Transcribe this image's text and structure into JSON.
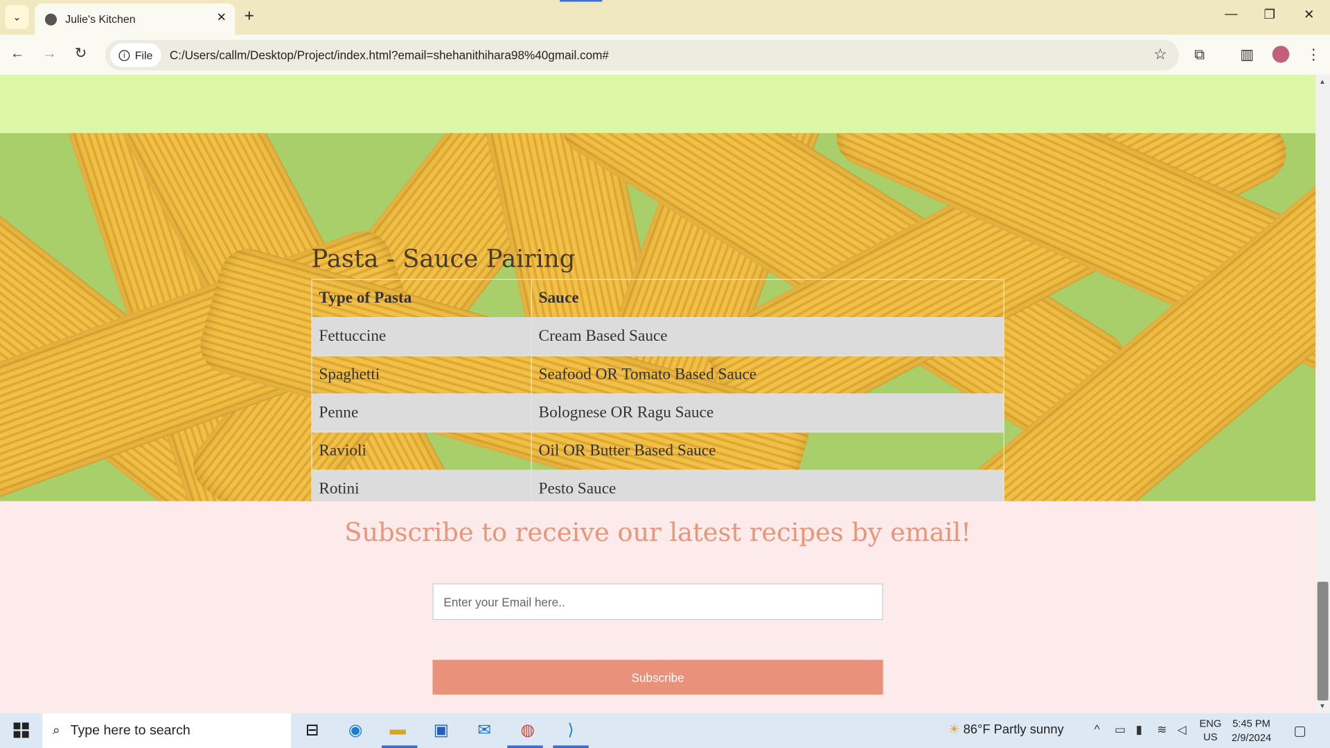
{
  "browser": {
    "tab_title": "Julie's Kitchen",
    "new_tab": "+",
    "url": "C:/Users/callm/Desktop/Project/index.html?email=shehanithihara98%40gmail.com#",
    "site_chip": "File"
  },
  "page": {
    "table_title": "Pasta - Sauce Pairing",
    "headers": [
      "Type of Pasta",
      "Sauce"
    ],
    "rows": [
      [
        "Fettuccine",
        "Cream Based Sauce"
      ],
      [
        "Spaghetti",
        "Seafood OR Tomato Based Sauce"
      ],
      [
        "Penne",
        "Bolognese OR Ragu Sauce"
      ],
      [
        "Ravioli",
        "Oil OR Butter Based Sauce"
      ],
      [
        "Rotini",
        "Pesto Sauce"
      ]
    ],
    "subscribe_title": "Subscribe to receive our latest recipes by email!",
    "email_placeholder": "Enter your Email here..",
    "subscribe_button": "Subscribe"
  },
  "taskbar": {
    "search_placeholder": "Type here to search",
    "weather": "86°F  Partly sunny",
    "lang1": "ENG",
    "lang2": "US",
    "time": "5:45 PM",
    "date": "2/9/2024"
  },
  "colors": {
    "accent_salmon": "#e9917a",
    "green_band": "#dcf7a6",
    "subscribe_bg": "#fdeaea"
  }
}
